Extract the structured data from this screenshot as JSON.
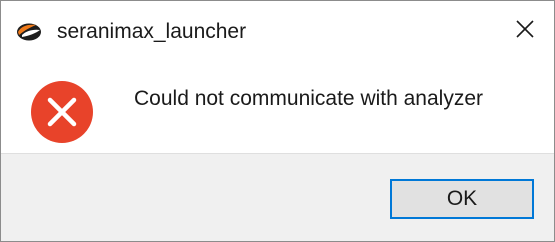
{
  "window": {
    "title": "seranimax_launcher",
    "app_icon": "seranimax-app-icon",
    "close_icon": "close-icon"
  },
  "message": {
    "icon": "error-icon",
    "text": "Could not communicate with analyzer"
  },
  "buttons": {
    "ok_label": "OK"
  },
  "colors": {
    "error_red": "#e8432a",
    "accent_border": "#0078d7",
    "footer_bg": "#f0f0f0",
    "button_bg": "#e1e1e1"
  }
}
